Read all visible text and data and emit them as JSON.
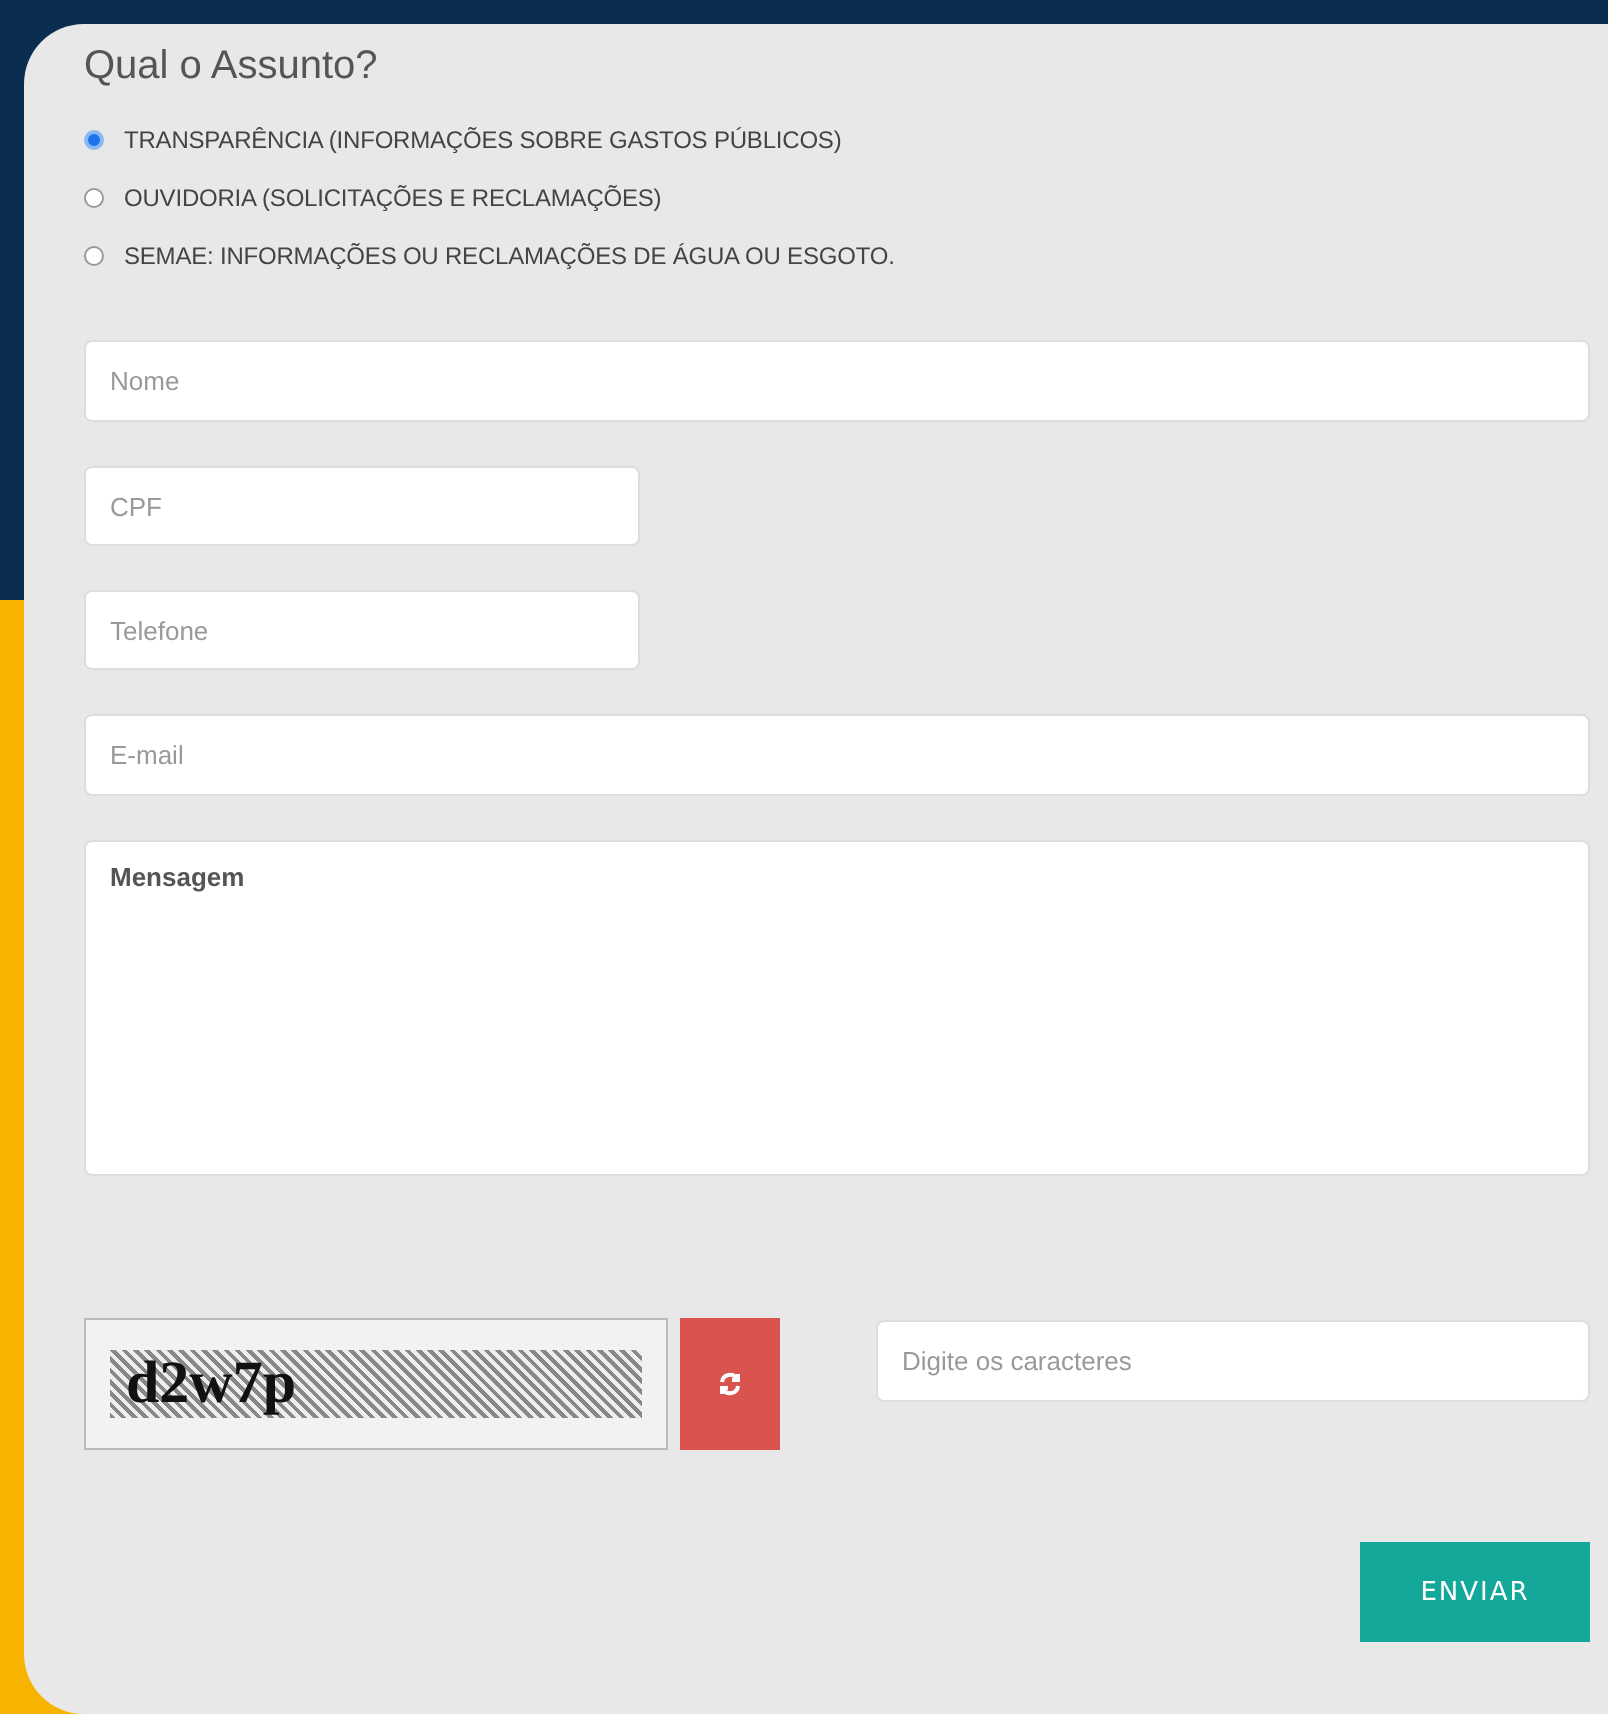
{
  "title": "Qual o Assunto?",
  "subjects": [
    {
      "label": "TRANSPARÊNCIA (INFORMAÇÕES SOBRE GASTOS PÚBLICOS)",
      "selected": true
    },
    {
      "label": "OUVIDORIA (SOLICITAÇÕES E RECLAMAÇÕES)",
      "selected": false
    },
    {
      "label": "SEMAE: INFORMAÇÕES OU RECLAMAÇÕES DE ÁGUA OU ESGOTO.",
      "selected": false
    }
  ],
  "fields": [
    {
      "placeholder": "Nome",
      "kind": "wide"
    },
    {
      "placeholder": "CPF",
      "kind": "short"
    },
    {
      "placeholder": "Telefone",
      "kind": "short"
    },
    {
      "placeholder": "E-mail",
      "kind": "wide"
    },
    {
      "placeholder": "Mensagem",
      "kind": "area"
    }
  ],
  "captcha": {
    "code": "d2w7p",
    "input_placeholder": "Digite os caracteres"
  },
  "submit": "ENVIAR"
}
